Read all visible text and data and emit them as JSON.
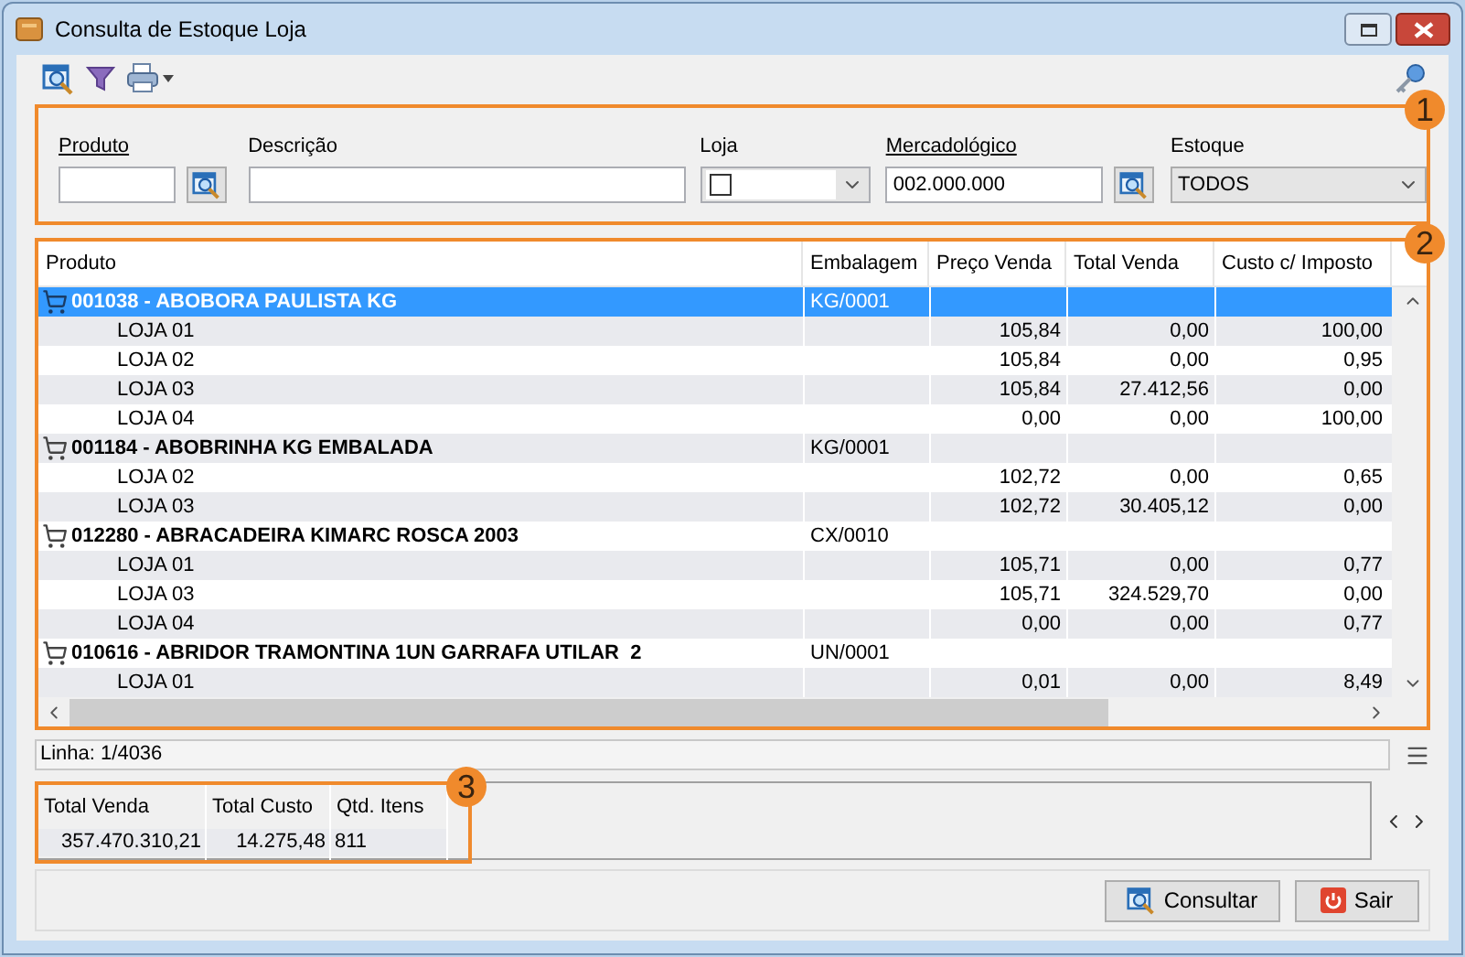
{
  "window": {
    "title": "Consulta de Estoque Loja"
  },
  "filters": [
    {
      "kind": "text",
      "label": "Produto",
      "underlined": true,
      "lookup": true
    },
    {
      "kind": "text",
      "label": "Descrição",
      "underlined": false,
      "lookup": false
    },
    {
      "kind": "checkcombo",
      "label": "Loja",
      "underlined": false,
      "checked": false
    },
    {
      "kind": "text",
      "label": "Mercadológico",
      "underlined": true,
      "value": "002.000.000",
      "lookup": true
    },
    {
      "kind": "combo",
      "label": "Estoque",
      "underlined": false,
      "value": "TODOS"
    }
  ],
  "badges": [
    "1",
    "2",
    "3"
  ],
  "grid": {
    "columns": [
      "Produto",
      "Embalagem",
      "Preço Venda",
      "Total Venda",
      "Custo c/ Imposto"
    ],
    "rows": [
      {
        "product": "001038 - ABOBORA PAULISTA KG",
        "embalagem": "KG/0001",
        "selected": true,
        "children": [
          {
            "loja": "LOJA 01",
            "preco": "105,84",
            "total": "0,00",
            "custo": "100,00"
          },
          {
            "loja": "LOJA 02",
            "preco": "105,84",
            "total": "0,00",
            "custo": "0,95"
          },
          {
            "loja": "LOJA 03",
            "preco": "105,84",
            "total": "27.412,56",
            "custo": "0,00"
          },
          {
            "loja": "LOJA 04",
            "preco": "0,00",
            "total": "0,00",
            "custo": "100,00"
          }
        ]
      },
      {
        "product": "001184 - ABOBRINHA KG EMBALADA",
        "embalagem": "KG/0001",
        "selected": false,
        "children": [
          {
            "loja": "LOJA 02",
            "preco": "102,72",
            "total": "0,00",
            "custo": "0,65"
          },
          {
            "loja": "LOJA 03",
            "preco": "102,72",
            "total": "30.405,12",
            "custo": "0,00"
          }
        ]
      },
      {
        "product": "012280 - ABRACADEIRA KIMARC ROSCA 2003",
        "embalagem": "CX/0010",
        "selected": false,
        "children": [
          {
            "loja": "LOJA 01",
            "preco": "105,71",
            "total": "0,00",
            "custo": "0,77"
          },
          {
            "loja": "LOJA 03",
            "preco": "105,71",
            "total": "324.529,70",
            "custo": "0,00"
          },
          {
            "loja": "LOJA 04",
            "preco": "0,00",
            "total": "0,00",
            "custo": "0,77"
          }
        ]
      },
      {
        "product": "010616 - ABRIDOR TRAMONTINA 1UN GARRAFA UTILAR  2",
        "embalagem": "UN/0001",
        "selected": false,
        "children": [
          {
            "loja": "LOJA 01",
            "preco": "0,01",
            "total": "0,00",
            "custo": "8,49"
          }
        ]
      }
    ]
  },
  "status": "Linha: 1/4036",
  "totals": {
    "columns": [
      "Total Venda",
      "Total Custo",
      "Qtd. Itens"
    ],
    "values": [
      "357.470.310,21",
      "14.275,48",
      "811"
    ]
  },
  "buttons": [
    {
      "kind": "search",
      "label": "Consultar"
    },
    {
      "kind": "exit",
      "label": "Sair"
    }
  ]
}
